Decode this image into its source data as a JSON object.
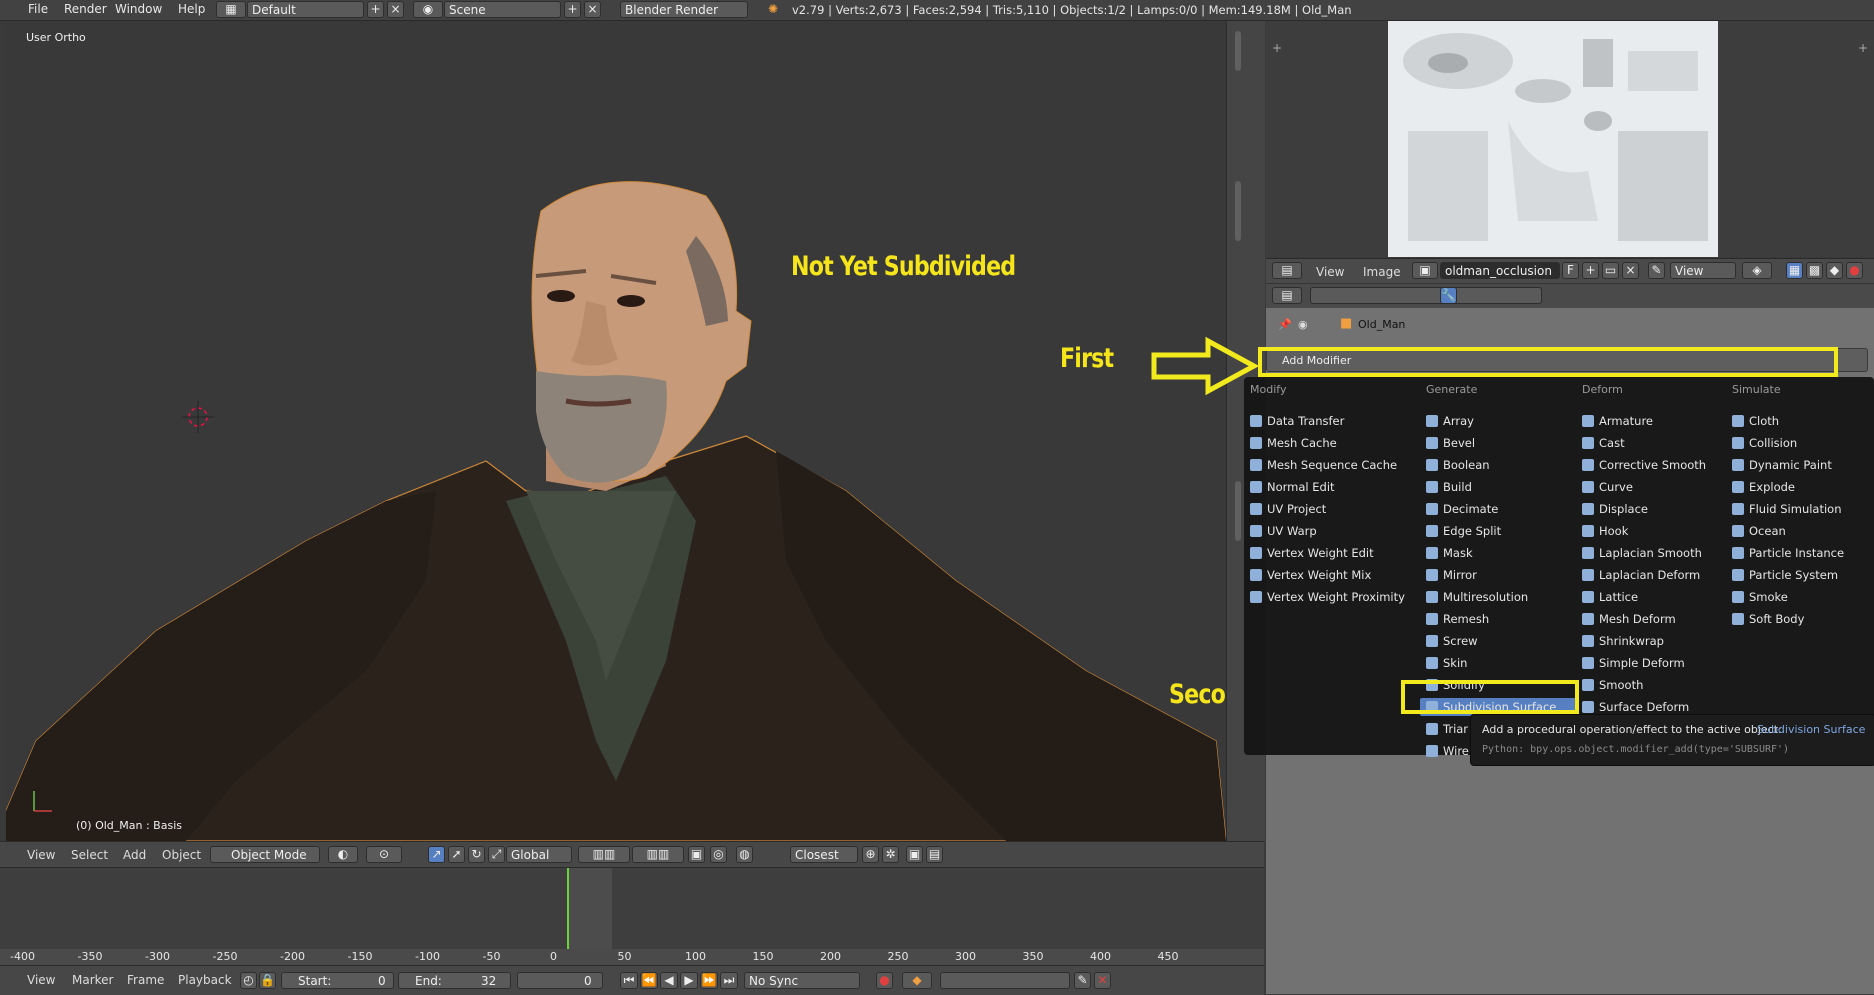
{
  "topbar": {
    "menus": [
      "File",
      "Render",
      "Window",
      "Help"
    ],
    "layout": "Default",
    "scene": "Scene",
    "engine": "Blender Render",
    "stats": "v2.79 | Verts:2,673 | Faces:2,594 | Tris:5,110 | Objects:1/2 | Lamps:0/0 | Mem:149.18M | Old_Man"
  },
  "viewport": {
    "view_label": "User Ortho",
    "object_label": "(0) Old_Man : Basis",
    "annotation_not_subdivided": "Not Yet Subdivided"
  },
  "viewport_header": {
    "menus": [
      "View",
      "Select",
      "Add",
      "Object"
    ],
    "mode": "Object Mode",
    "orientation": "Global",
    "snap": "Closest"
  },
  "image_editor": {
    "menus": [
      "View",
      "Image"
    ],
    "image_name": "oldman_occlusion",
    "fake_user": "F",
    "view_dropdown": "View"
  },
  "properties": {
    "object_name": "Old_Man",
    "add_modifier": "Add Modifier"
  },
  "annotations": {
    "first": "First",
    "second": "Second"
  },
  "add_modifier_menu": {
    "columns": [
      {
        "header": "Modify",
        "items": [
          "Data Transfer",
          "Mesh Cache",
          "Mesh Sequence Cache",
          "Normal Edit",
          "UV Project",
          "UV Warp",
          "Vertex Weight Edit",
          "Vertex Weight Mix",
          "Vertex Weight Proximity"
        ]
      },
      {
        "header": "Generate",
        "items": [
          "Array",
          "Bevel",
          "Boolean",
          "Build",
          "Decimate",
          "Edge Split",
          "Mask",
          "Mirror",
          "Multiresolution",
          "Remesh",
          "Screw",
          "Skin",
          "Solidify",
          "Subdivision Surface",
          "Triar",
          "Wire"
        ]
      },
      {
        "header": "Deform",
        "items": [
          "Armature",
          "Cast",
          "Corrective Smooth",
          "Curve",
          "Displace",
          "Hook",
          "Laplacian Smooth",
          "Laplacian Deform",
          "Lattice",
          "Mesh Deform",
          "Shrinkwrap",
          "Simple Deform",
          "Smooth",
          "Surface Deform"
        ]
      },
      {
        "header": "Simulate",
        "items": [
          "Cloth",
          "Collision",
          "Dynamic Paint",
          "Explode",
          "Fluid Simulation",
          "Ocean",
          "Particle Instance",
          "Particle System",
          "Smoke",
          "Soft Body"
        ]
      }
    ],
    "highlighted": "Subdivision Surface"
  },
  "tooltip": {
    "description": "Add a procedural operation/effect to the active object:",
    "target": "Subdivision Surface",
    "python": "Python: bpy.ops.object.modifier_add(type='SUBSURF')"
  },
  "timeline": {
    "ticks": [
      "-400",
      "-350",
      "-300",
      "-250",
      "-200",
      "-150",
      "-100",
      "-50",
      "0",
      "50",
      "100",
      "150",
      "200",
      "250",
      "300",
      "350",
      "400",
      "450"
    ],
    "current_frame": 0,
    "menus": [
      "View",
      "Marker",
      "Frame",
      "Playback"
    ],
    "start_label": "Start:",
    "start_value": "0",
    "end_label": "End:",
    "end_value": "32",
    "frame_value": "0",
    "sync": "No Sync"
  },
  "colors": {
    "annotation_yellow": "#f2ea1c",
    "menu_highlight": "#5680c2",
    "selection_orange": "#f0a040"
  }
}
